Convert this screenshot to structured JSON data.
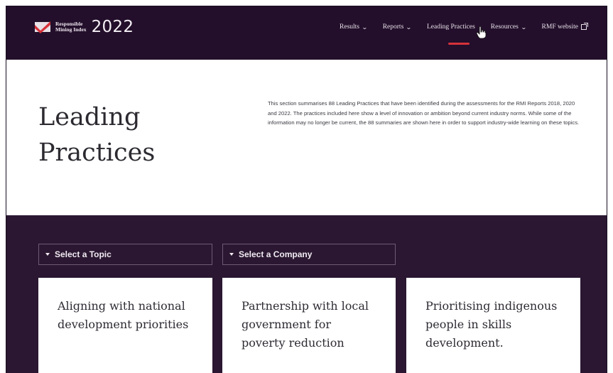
{
  "header": {
    "logo_line1": "Responsible",
    "logo_line2": "Mining Index",
    "logo_year": "2022",
    "brand_colors": {
      "background": "#230f2b",
      "accent": "#d6323b"
    }
  },
  "nav": {
    "items": [
      {
        "label": "Results",
        "icon": "chevron-down-icon"
      },
      {
        "label": "Reports",
        "icon": "chevron-down-icon"
      },
      {
        "label": "Leading Practices",
        "active": true
      },
      {
        "label": "Resources",
        "icon": "chevron-down-icon"
      },
      {
        "label": "RMF website",
        "icon": "external-link-icon"
      }
    ]
  },
  "hero": {
    "title_line1": "Leading",
    "title_line2": "Practices",
    "description": "This section summarises 88 Leading Practices that have been identified during the assessments for the RMI Reports 2018, 2020 and 2022. The practices included here show a level of innovation or ambition beyond current industry norms. While some of the information may no longer be current, the 88 summaries are shown here in order to support industry-wide learning on these topics."
  },
  "filters": {
    "topic_label": "Select a Topic",
    "company_label": "Select a Company"
  },
  "cards": [
    {
      "title": "Aligning with national development priorities"
    },
    {
      "title": "Partnership with local government for poverty reduction"
    },
    {
      "title": "Prioritising indigenous people in skills development."
    }
  ]
}
